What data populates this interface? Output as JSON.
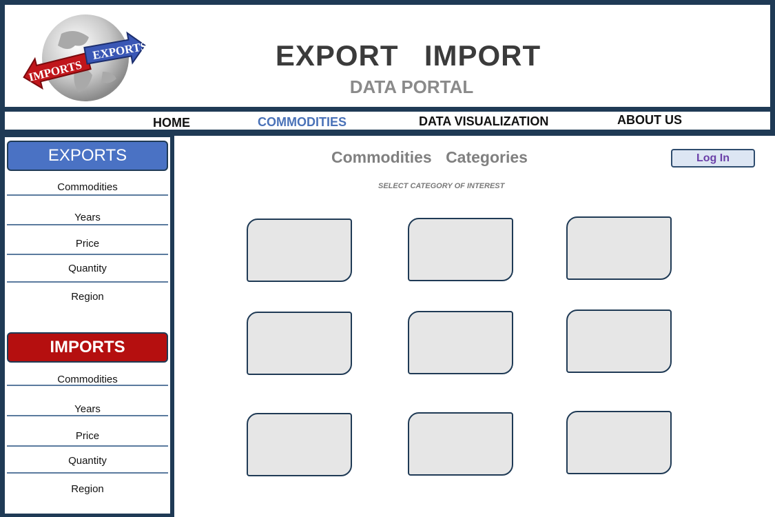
{
  "header": {
    "title": "EXPORT  IMPORT",
    "subtitle": "DATA PORTAL",
    "logo": {
      "left_label": "IMPORTS",
      "right_label": "EXPORTS"
    }
  },
  "nav": {
    "items": [
      {
        "label": "HOME"
      },
      {
        "label": "COMMODITIES"
      },
      {
        "label": "DATA VISUALIZATION"
      },
      {
        "label": "ABOUT US"
      }
    ],
    "active": "COMMODITIES"
  },
  "sidebar": {
    "exports": {
      "label": "EXPORTS",
      "items": [
        "Commodities",
        "Years",
        "Price",
        "Quantity",
        "Region"
      ]
    },
    "imports": {
      "label": "IMPORTS",
      "items": [
        "Commodities",
        "Years",
        "Price",
        "Quantity",
        "Region"
      ]
    }
  },
  "main": {
    "title": "Commodities Categories",
    "subtitle": "SELECT CATEGORY OF INTEREST",
    "login_label": "Log In"
  },
  "colors": {
    "frame": "#1f3a55",
    "exports": "#4a72c4",
    "imports": "#b50f0f",
    "nav_active": "#4a72b8",
    "card_fill": "#e6e6e6"
  }
}
